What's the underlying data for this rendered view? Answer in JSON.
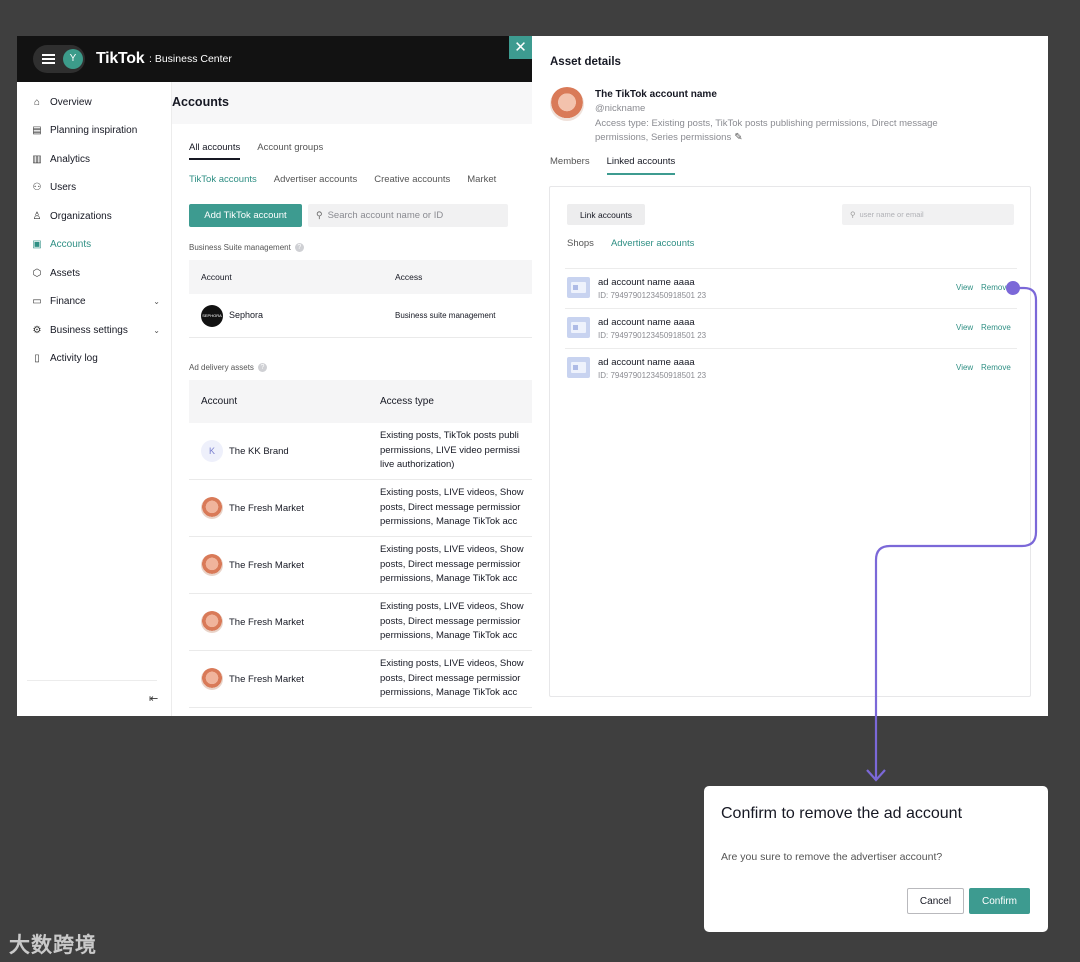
{
  "app": {
    "brand": "TikTok",
    "brand_sub": ": Business Center",
    "avatar_initial": "Y"
  },
  "sidebar": {
    "items": [
      {
        "label": "Overview",
        "icon": "home-icon"
      },
      {
        "label": "Planning inspiration",
        "icon": "planning-icon"
      },
      {
        "label": "Analytics",
        "icon": "analytics-icon"
      },
      {
        "label": "Users",
        "icon": "users-icon"
      },
      {
        "label": "Organizations",
        "icon": "organizations-icon"
      },
      {
        "label": "Accounts",
        "icon": "accounts-icon",
        "active": true
      },
      {
        "label": "Assets",
        "icon": "assets-icon"
      },
      {
        "label": "Finance",
        "icon": "finance-icon"
      },
      {
        "label": "Business settings",
        "icon": "settings-icon"
      },
      {
        "label": "Activity log",
        "icon": "log-icon"
      }
    ]
  },
  "main": {
    "title": "Accounts",
    "tabs": [
      "All accounts",
      "Account groups"
    ],
    "subtabs": [
      "TikTok accounts",
      "Advertiser accounts",
      "Creative accounts",
      "Market"
    ],
    "add_button": "Add TikTok account",
    "search_placeholder": "Search account name or ID",
    "business_suite": {
      "label": "Business Suite management",
      "headers": [
        "Account",
        "Access"
      ],
      "rows": [
        {
          "account": "Sephora",
          "access": "Business suite management",
          "avatar_text": "SEPHORA"
        }
      ]
    },
    "ad_delivery": {
      "label": "Ad delivery assets",
      "headers": [
        "Account",
        "Access type"
      ],
      "rows": [
        {
          "account": "The KK Brand",
          "avatar_text": "K",
          "access": [
            "Existing posts, TikTok posts publi",
            "permissions, LIVE video permissi",
            "live authorization)"
          ]
        },
        {
          "account": "The Fresh Market",
          "access": [
            "Existing posts, LIVE videos, Show",
            "posts, Direct message permissior",
            "permissions, Manage TikTok acc"
          ]
        },
        {
          "account": "The Fresh Market",
          "access": [
            "Existing posts, LIVE videos, Show",
            "posts, Direct message permissior",
            "permissions, Manage TikTok acc"
          ]
        },
        {
          "account": "The Fresh Market",
          "access": [
            "Existing posts, LIVE videos, Show",
            "posts, Direct message permissior",
            "permissions, Manage TikTok acc"
          ]
        },
        {
          "account": "The Fresh Market",
          "access": [
            "Existing posts, LIVE videos, Show",
            "posts, Direct message permissior",
            "permissions, Manage TikTok acc"
          ]
        }
      ]
    }
  },
  "panel": {
    "title": "Asset details",
    "account_name": "The TikTok account name",
    "nickname": "@nickname",
    "access_line1": "Access type: Existing posts, TikTok posts publishing permissions, Direct message",
    "access_line2": "permissions, Series permissions",
    "tabs": [
      "Members",
      "Linked accounts"
    ],
    "link_button": "Link accounts",
    "search_placeholder": "user name or email",
    "subtabs": [
      "Shops",
      "Advertiser accounts"
    ],
    "accounts": [
      {
        "name": "ad account name aaaa",
        "id": "ID: 7949790123450918501 23",
        "view": "View",
        "remove": "Remove"
      },
      {
        "name": "ad account name aaaa",
        "id": "ID: 7949790123450918501 23",
        "view": "View",
        "remove": "Remove"
      },
      {
        "name": "ad account name aaaa",
        "id": "ID: 7949790123450918501 23",
        "view": "View",
        "remove": "Remove"
      }
    ]
  },
  "dialog": {
    "title": "Confirm to remove the ad account",
    "message": "Are you sure to remove the advertiser account?",
    "cancel": "Cancel",
    "confirm": "Confirm"
  },
  "watermark": "大数跨境",
  "colors": {
    "accent": "#3d9b90",
    "connector": "#7b68d8",
    "background": "#3f3f3f"
  }
}
